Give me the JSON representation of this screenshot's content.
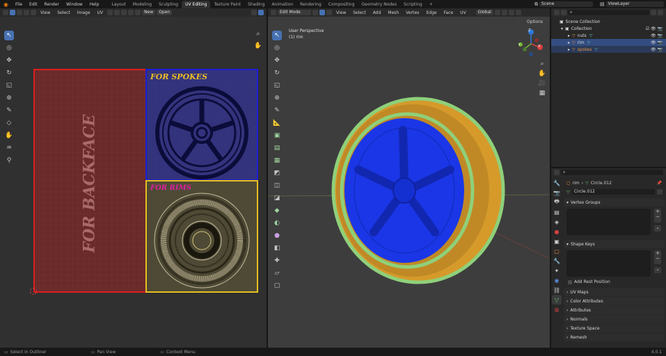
{
  "topbar": {
    "menus": [
      "File",
      "Edit",
      "Render",
      "Window",
      "Help"
    ],
    "workspaces": [
      "Layout",
      "Modeling",
      "Sculpting",
      "UV Editing",
      "Texture Paint",
      "Shading",
      "Animation",
      "Rendering",
      "Compositing",
      "Geometry Nodes",
      "Scripting"
    ],
    "active_workspace": "UV Editing",
    "add_tab": "+",
    "scene": "Scene",
    "view_layer": "ViewLayer"
  },
  "uv_editor": {
    "menus": [
      "View",
      "Select",
      "Image",
      "UV"
    ],
    "new_label": "New",
    "open_label": "Open",
    "regions": {
      "backface": "FOR BACKFACE",
      "spokes": "FOR SPOKES",
      "rims": "FOR RIMS"
    }
  },
  "viewport": {
    "mode": "Edit Mode",
    "menus": [
      "View",
      "Select",
      "Add",
      "Mesh",
      "Vertex",
      "Edge",
      "Face",
      "UV"
    ],
    "orientation": "Global",
    "options": "Options",
    "overlay_title": "User Perspective",
    "overlay_object": "(1) rim",
    "gizmo": {
      "x": "X",
      "y": "Y",
      "z": "Z"
    }
  },
  "outliner": {
    "root": "Scene Collection",
    "collection": "Collection",
    "items": [
      "nuts",
      "rim",
      "spokes"
    ]
  },
  "properties": {
    "breadcrumb_object": "rim",
    "breadcrumb_mesh": "Circle.012",
    "mesh_name": "Circle.012",
    "sections": {
      "vertex_groups": "Vertex Groups",
      "shape_keys": "Shape Keys",
      "add_rest": "Add Rest Position",
      "uv_maps": "UV Maps",
      "color_attributes": "Color Attributes",
      "attributes": "Attributes",
      "normals": "Normals",
      "texture_space": "Texture Space",
      "remesh": "Remesh"
    }
  },
  "statusbar": {
    "select": "Select in Outliner",
    "pan": "Pan View",
    "context": "Context Menu",
    "version": "4.0.1"
  },
  "colors": {
    "accent": "#4772b3",
    "backface": "#6b2a2a",
    "spokes": "#2e2e7a",
    "rims": "#4a4530",
    "rim_mesh": "#1a36e6",
    "tire_mesh": "#d59a2a"
  }
}
